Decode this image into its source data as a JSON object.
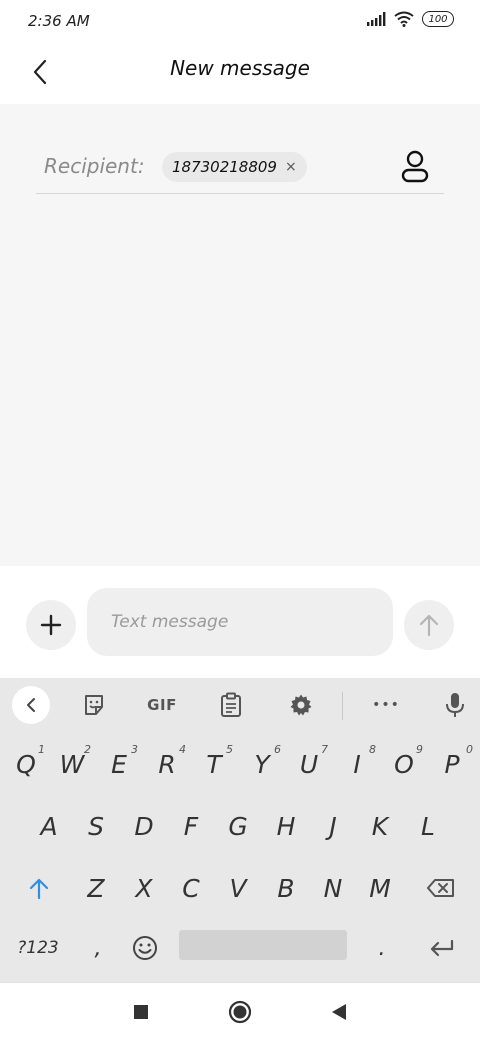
{
  "status_bar": {
    "time": "2:36 AM",
    "battery": "100"
  },
  "app_bar": {
    "title": "New message"
  },
  "recipient": {
    "label": "Recipient:",
    "chip": "18730218809",
    "chip_close": "×"
  },
  "compose": {
    "placeholder": "Text message"
  },
  "keyboard": {
    "toolbar": {
      "gif_label": "GIF",
      "more_label": "•••"
    },
    "row1": [
      {
        "k": "Q",
        "s": "1"
      },
      {
        "k": "W",
        "s": "2"
      },
      {
        "k": "E",
        "s": "3"
      },
      {
        "k": "R",
        "s": "4"
      },
      {
        "k": "T",
        "s": "5"
      },
      {
        "k": "Y",
        "s": "6"
      },
      {
        "k": "U",
        "s": "7"
      },
      {
        "k": "I",
        "s": "8"
      },
      {
        "k": "O",
        "s": "9"
      },
      {
        "k": "P",
        "s": "0"
      }
    ],
    "row2": [
      "A",
      "S",
      "D",
      "F",
      "G",
      "H",
      "J",
      "K",
      "L"
    ],
    "row3": [
      "Z",
      "X",
      "C",
      "V",
      "B",
      "N",
      "M"
    ],
    "row4": {
      "symbols": "?123",
      "comma": ",",
      "period": "."
    }
  }
}
